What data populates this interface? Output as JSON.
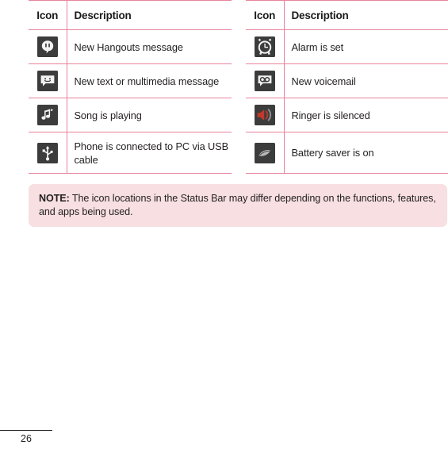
{
  "page": {
    "number": "26"
  },
  "tables": [
    {
      "name": "status-icons-table-left",
      "headers": {
        "icon": "Icon",
        "description": "Description"
      },
      "rows": [
        {
          "icon": "hangouts-message-icon",
          "description": "New Hangouts message"
        },
        {
          "icon": "text-multimedia-message-icon",
          "description": "New text or multimedia message"
        },
        {
          "icon": "music-note-icon",
          "description": "Song is playing"
        },
        {
          "icon": "usb-icon",
          "description": "Phone is connected to PC via USB cable"
        }
      ]
    },
    {
      "name": "status-icons-table-right",
      "headers": {
        "icon": "Icon",
        "description": "Description"
      },
      "rows": [
        {
          "icon": "alarm-clock-icon",
          "description": "Alarm is set"
        },
        {
          "icon": "voicemail-icon",
          "description": "New voicemail"
        },
        {
          "icon": "ringer-silenced-icon",
          "description": "Ringer is silenced"
        },
        {
          "icon": "battery-saver-icon",
          "description": "Battery saver is on"
        }
      ]
    }
  ],
  "note": {
    "label": "NOTE:",
    "text": "The icon locations in the Status Bar may differ depending on the functions, features, and apps being used."
  },
  "colors": {
    "table_rule": "#e8849c",
    "note_background": "#f7dfe2",
    "text": "#231f20",
    "icon_chip_background": "#3a3a3a"
  }
}
